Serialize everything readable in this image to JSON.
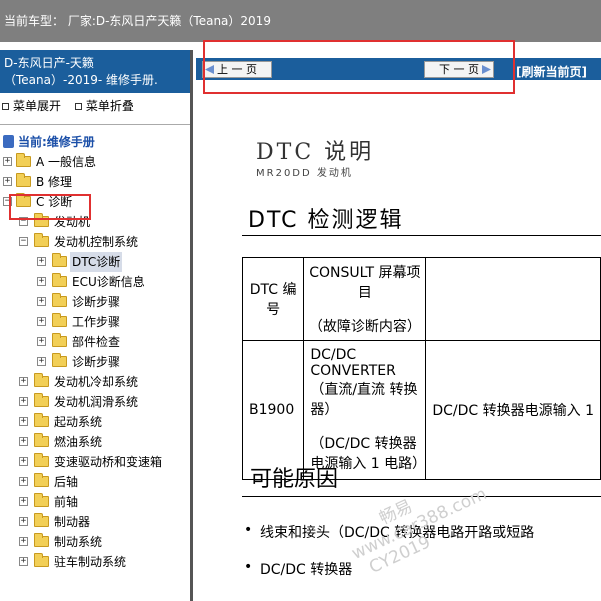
{
  "topbar": {
    "text": "当前车型： 厂家:D-东风日产天籁（Teana）2019"
  },
  "sidebar": {
    "header_line1": "D-东风日产-天籁",
    "header_line2": "（Teana）-2019- 维修手册.",
    "expand_label": "菜单展开",
    "collapse_label": "菜单折叠",
    "root_label": "当前:维修手册",
    "items": [
      {
        "label": "A 一般信息"
      },
      {
        "label": "B 修理"
      },
      {
        "label": "C 诊断"
      },
      {
        "label": "发动机"
      },
      {
        "label": "发动机控制系统"
      },
      {
        "label": "DTC诊断"
      },
      {
        "label": "ECU诊断信息"
      },
      {
        "label": "诊断步骤"
      },
      {
        "label": "工作步骤"
      },
      {
        "label": "部件检查"
      },
      {
        "label": "诊断步骤"
      },
      {
        "label": "发动机冷却系统"
      },
      {
        "label": "发动机润滑系统"
      },
      {
        "label": "起动系统"
      },
      {
        "label": "燃油系统"
      },
      {
        "label": "变速驱动桥和变速箱"
      },
      {
        "label": "后轴"
      },
      {
        "label": "前轴"
      },
      {
        "label": "制动器"
      },
      {
        "label": "制动系统"
      },
      {
        "label": "驻车制动系统"
      }
    ]
  },
  "nav": {
    "prev_label": "上 一 页",
    "next_label": "下 一 页",
    "refresh_label": "[刷新当前页]"
  },
  "doc": {
    "title": "DTC 说明",
    "subtitle": "MR20DD 发动机",
    "section1": "DTC 检测逻辑",
    "table": {
      "h1": "DTC 编号",
      "h2a": "CONSULT 屏幕项目",
      "h2b": "（故障诊断内容）",
      "code": "B1900",
      "item_a": "DC/DC CONVERTER（直流/直流 转换器）",
      "item_b": "（DC/DC 转换器电源输入 1 电路）",
      "col3": "DC/DC 转换器电源输入 1"
    },
    "section2": "可能原因",
    "bullets": [
      "线束和接头（DC/DC 转换器电路开路或短路",
      "DC/DC 转换器"
    ]
  },
  "watermark": {
    "line1": "畅易",
    "line2": "www.car388.com",
    "line3": "CY2019"
  }
}
